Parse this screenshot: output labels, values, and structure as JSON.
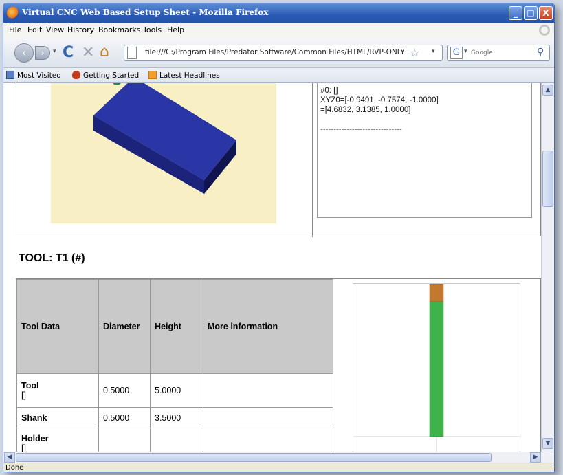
{
  "window": {
    "title": "Virtual CNC Web Based Setup Sheet - Mozilla Firefox",
    "min_glyph": "_",
    "max_glyph": "□",
    "close_glyph": "X"
  },
  "menu": [
    "File",
    "Edit",
    "View",
    "History",
    "Bookmarks",
    "Tools",
    "Help"
  ],
  "nav": {
    "url": "file:///C:/Program Files/Predator Software/Common Files/HTML/RVP-ONLY!.h",
    "search_placeholder": "Google",
    "back_glyph": "‹",
    "forward_glyph": "›",
    "reload_glyph": "C",
    "stop_glyph": "✕",
    "home_glyph": "⌂",
    "star_glyph": "☆",
    "dropdown_glyph": "▾",
    "search_engine_glyph": "G",
    "search_glyph": "⚲"
  },
  "bookmarks": [
    "Most Visited",
    "Getting Started",
    "Latest Headlines"
  ],
  "setup_info": {
    "lines": [
      "#0: []",
      "XYZ0=[-0.9491, -0.7574, -1.0000]",
      "=[4.6832, 3.1385, 1.0000]",
      "",
      "-------------------------------"
    ]
  },
  "tool": {
    "heading": "TOOL: T1 (#)",
    "columns": [
      "Tool Data",
      "Diameter",
      "Height",
      "More information"
    ],
    "rows": [
      {
        "name": "Tool",
        "sub": "[]",
        "diameter": "0.5000",
        "height": "5.0000",
        "info": ""
      },
      {
        "name": "Shank",
        "sub": "",
        "diameter": "0.5000",
        "height": "3.5000",
        "info": ""
      },
      {
        "name": "Holder",
        "sub": "[]",
        "diameter": "",
        "height": "",
        "info": ""
      }
    ]
  },
  "scrollbars": {
    "up_glyph": "▲",
    "down_glyph": "▼",
    "left_glyph": "◀",
    "right_glyph": "▶"
  },
  "status": "Done",
  "colors": {
    "titlebar": "#2b5bb4",
    "part_top": "#2a36a6",
    "part_side": "#141a5a",
    "preview_bg": "#f8f0c4",
    "tool_cutter": "#3fb24a",
    "tool_holder": "#c2782e",
    "table_header": "#c9c9c9"
  }
}
